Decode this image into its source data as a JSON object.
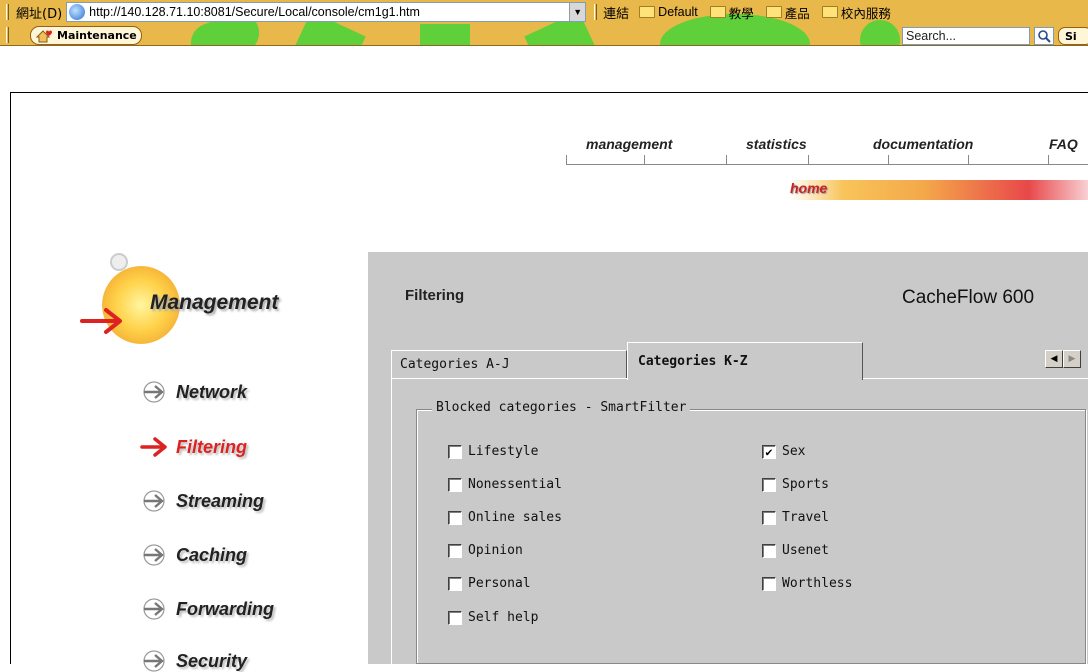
{
  "browser": {
    "address_label": "網址(D)",
    "url": "http://140.128.71.10:8081/Secure/Local/console/cm1g1.htm",
    "links_label": "連結",
    "links": [
      "Default",
      "教學",
      "產品",
      "校內服務"
    ],
    "maintenance_label": "Maintenance",
    "search_placeholder": "Search...",
    "site_label": "Si"
  },
  "topnav": {
    "items": [
      "management",
      "statistics",
      "documentation",
      "FAQ"
    ],
    "home_label": "home"
  },
  "sidebar": {
    "title": "Management",
    "items": [
      {
        "label": "Network",
        "active": false
      },
      {
        "label": "Filtering",
        "active": true
      },
      {
        "label": "Streaming",
        "active": false
      },
      {
        "label": "Caching",
        "active": false
      },
      {
        "label": "Forwarding",
        "active": false
      },
      {
        "label": "Security",
        "active": false
      }
    ]
  },
  "content": {
    "section_title": "Filtering",
    "product_name": "CacheFlow 600",
    "tabs": [
      {
        "label": "Categories A-J",
        "active": false
      },
      {
        "label": "Categories K-Z",
        "active": true
      }
    ],
    "group_title": "Blocked categories - SmartFilter",
    "categories_left": [
      {
        "label": "Lifestyle",
        "checked": false
      },
      {
        "label": "Nonessential",
        "checked": false
      },
      {
        "label": "Online sales",
        "checked": false
      },
      {
        "label": "Opinion",
        "checked": false
      },
      {
        "label": "Personal",
        "checked": false
      },
      {
        "label": "Self help",
        "checked": false
      }
    ],
    "categories_right": [
      {
        "label": "Sex",
        "checked": true
      },
      {
        "label": "Sports",
        "checked": false
      },
      {
        "label": "Travel",
        "checked": false
      },
      {
        "label": "Usenet",
        "checked": false
      },
      {
        "label": "Worthless",
        "checked": false
      }
    ]
  },
  "colors": {
    "toolbar_bg": "#e8b84a",
    "panel_bg": "#c9c9c9",
    "active_nav": "#dd2222",
    "arrow_red": "#dd2222",
    "arrow_gray": "#777777"
  }
}
